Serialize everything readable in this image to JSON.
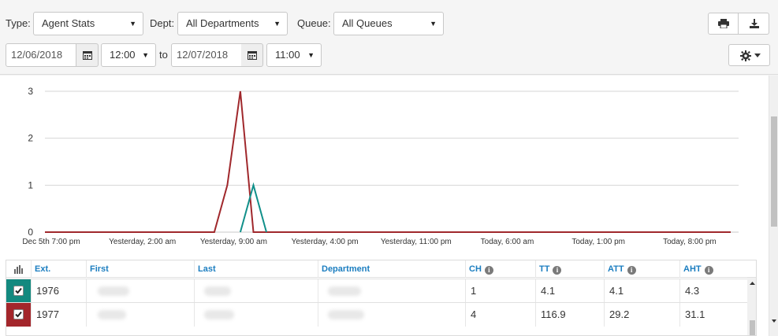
{
  "filters": {
    "type_label": "Type:",
    "type_value": "Agent Stats",
    "dept_label": "Dept:",
    "dept_value": "All Departments",
    "queue_label": "Queue:",
    "queue_value": "All Queues",
    "start_date": "12/06/2018",
    "start_time": "12:00",
    "to_label": "to",
    "end_date": "12/07/2018",
    "end_time": "11:00"
  },
  "actions": {
    "print_icon": "print-icon",
    "download_icon": "download-icon",
    "settings_icon": "gear-icon"
  },
  "chart_data": {
    "type": "line",
    "ylim": [
      0,
      3
    ],
    "yticks": [
      "0",
      "1",
      "2",
      "3"
    ],
    "xticks": [
      "Dec 5th 7:00 pm",
      "Yesterday, 2:00 am",
      "Yesterday, 9:00 am",
      "Yesterday, 4:00 pm",
      "Yesterday, 11:00 pm",
      "Today, 6:00 am",
      "Today, 1:00 pm",
      "Today, 8:00 pm"
    ],
    "grid": true,
    "series": [
      {
        "color": "#a0282c",
        "points": [
          [
            "Dec 5th 7:00 pm",
            0
          ],
          [
            "Yesterday, 8:00 am",
            0
          ],
          [
            "Yesterday, 9:00 am",
            1
          ],
          [
            "Yesterday, 10:00 am",
            3
          ],
          [
            "Yesterday, 11:00 am",
            0
          ],
          [
            "Today, 11:00 pm",
            0
          ]
        ]
      },
      {
        "color": "#11908a",
        "points": [
          [
            "Yesterday, 10:00 am",
            0
          ],
          [
            "Yesterday, 11:00 am",
            1
          ],
          [
            "Yesterday, 12:00 pm",
            0
          ]
        ]
      }
    ]
  },
  "table": {
    "columns": {
      "ext": "Ext.",
      "first": "First",
      "last": "Last",
      "department": "Department",
      "ch": "CH",
      "tt": "TT",
      "att": "ATT",
      "aht": "AHT"
    },
    "rows": [
      {
        "color": "#13897f",
        "ext": "1976",
        "ch": "1",
        "tt": "4.1",
        "att": "4.1",
        "aht": "4.3"
      },
      {
        "color": "#a3262b",
        "ext": "1977",
        "ch": "4",
        "tt": "116.9",
        "att": "29.2",
        "aht": "31.1"
      }
    ]
  }
}
